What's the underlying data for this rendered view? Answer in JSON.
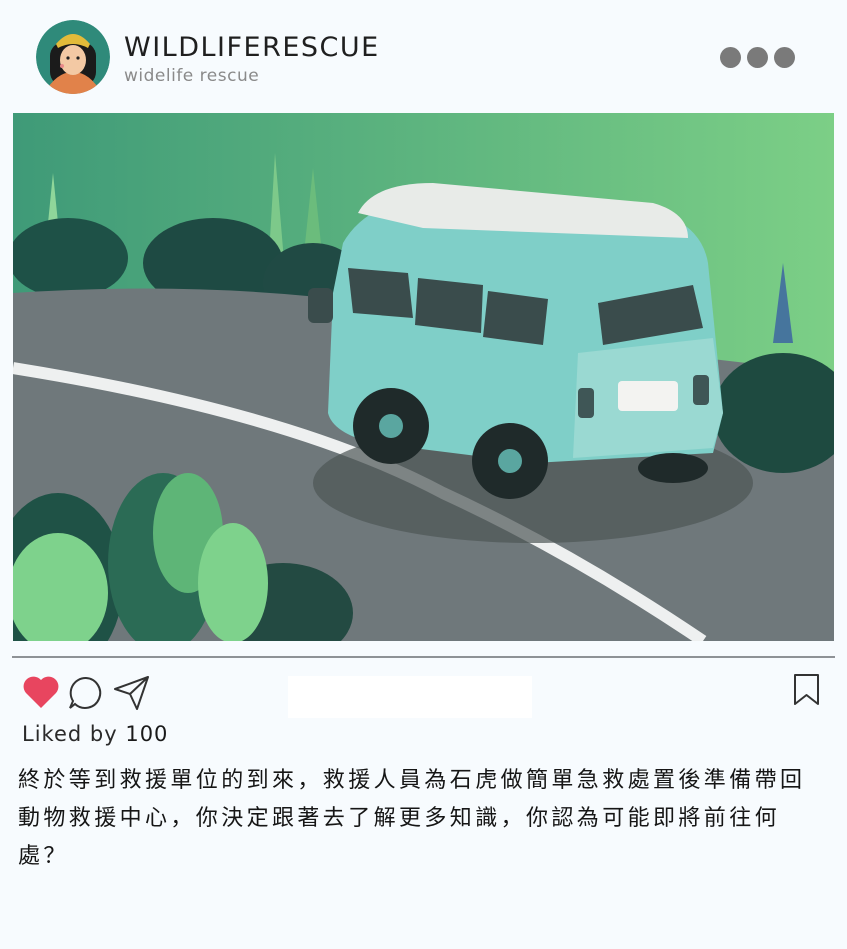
{
  "post": {
    "username": "WILDLIFERESCUE",
    "handle": "widelife rescue",
    "likes_prefix": "Liked by",
    "likes_count": "100",
    "caption": "終於等到救援單位的到來，救援人員為石虎做簡單急救處置後準備帶回動物救援中心，你決定跟著去了解更多知識，你認為可能即將前往何處？"
  },
  "icons": {
    "more": "more-options-icon",
    "like": "heart-icon",
    "comment": "comment-bubble-icon",
    "share": "paper-plane-icon",
    "save": "bookmark-icon"
  },
  "colors": {
    "background": "#f7fbfe",
    "heart": "#e8455f",
    "van": "#7fcfc8",
    "road": "#6f787b"
  }
}
